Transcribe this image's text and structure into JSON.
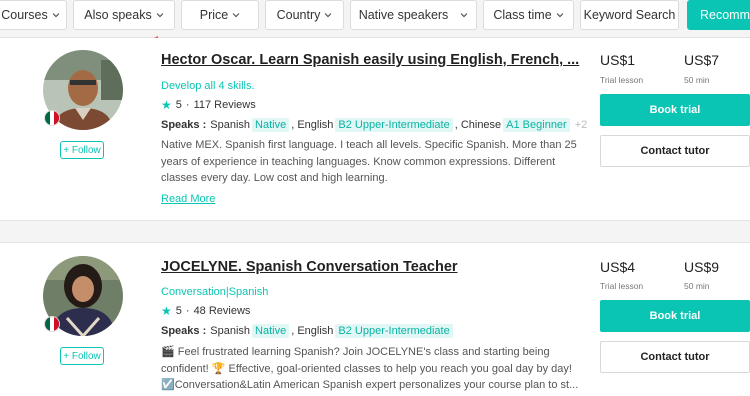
{
  "filters": {
    "courses": "Courses",
    "also_speaks": "Also speaks",
    "price": "Price",
    "country": "Country",
    "native_speakers": "Native speakers",
    "class_time": "Class time",
    "keyword_search": "Keyword Search",
    "recommend": "Recomme"
  },
  "colors": {
    "accent": "#0bc5b4",
    "arrow": "#e8483b"
  },
  "tutors": [
    {
      "name": "Hector Oscar. Learn Spanish easily using English, French, ...",
      "subtitle": "Develop all 4 skills.",
      "rating": "5",
      "reviews": "117 Reviews",
      "speaks_label": "Speaks :",
      "languages": [
        {
          "lang": "Spanish",
          "level": "Native",
          "sep": ","
        },
        {
          "lang": "English",
          "level": "B2 Upper-Intermediate",
          "sep": ","
        },
        {
          "lang": "Chinese",
          "level": "A1 Beginner",
          "sep": ""
        }
      ],
      "more_languages": "+2",
      "description": "Native MEX. Spanish first language. I teach all levels. Specific Spanish. More than 25 years of experience in teaching languages. Know common expressions. Different classes every day. Low cost and high learning.",
      "read_more": "Read More",
      "trial_price": "US$1",
      "trial_label": "Trial lesson",
      "lesson_price": "US$7",
      "lesson_label": "50 min",
      "book_trial": "Book trial",
      "contact": "Contact tutor",
      "follow": "+ Follow"
    },
    {
      "name": "JOCELYNE. Spanish Conversation Teacher",
      "subtitle": "Conversation|Spanish",
      "rating": "5",
      "reviews": "48 Reviews",
      "speaks_label": "Speaks :",
      "languages": [
        {
          "lang": "Spanish",
          "level": "Native",
          "sep": ","
        },
        {
          "lang": "English",
          "level": "B2 Upper-Intermediate",
          "sep": ""
        }
      ],
      "description_lines": [
        "🎬 Feel frustrated learning Spanish? Join JOCELYNE's class and starting being",
        "confident! 🏆 Effective, goal-oriented classes to help you reach you goal day by day!",
        "☑️Conversation&Latin American Spanish expert personalizes your course plan to st..."
      ],
      "trial_price": "US$4",
      "trial_label": "Trial lesson",
      "lesson_price": "US$9",
      "lesson_label": "50 min",
      "book_trial": "Book trial",
      "contact": "Contact tutor",
      "follow": "+ Follow"
    }
  ]
}
